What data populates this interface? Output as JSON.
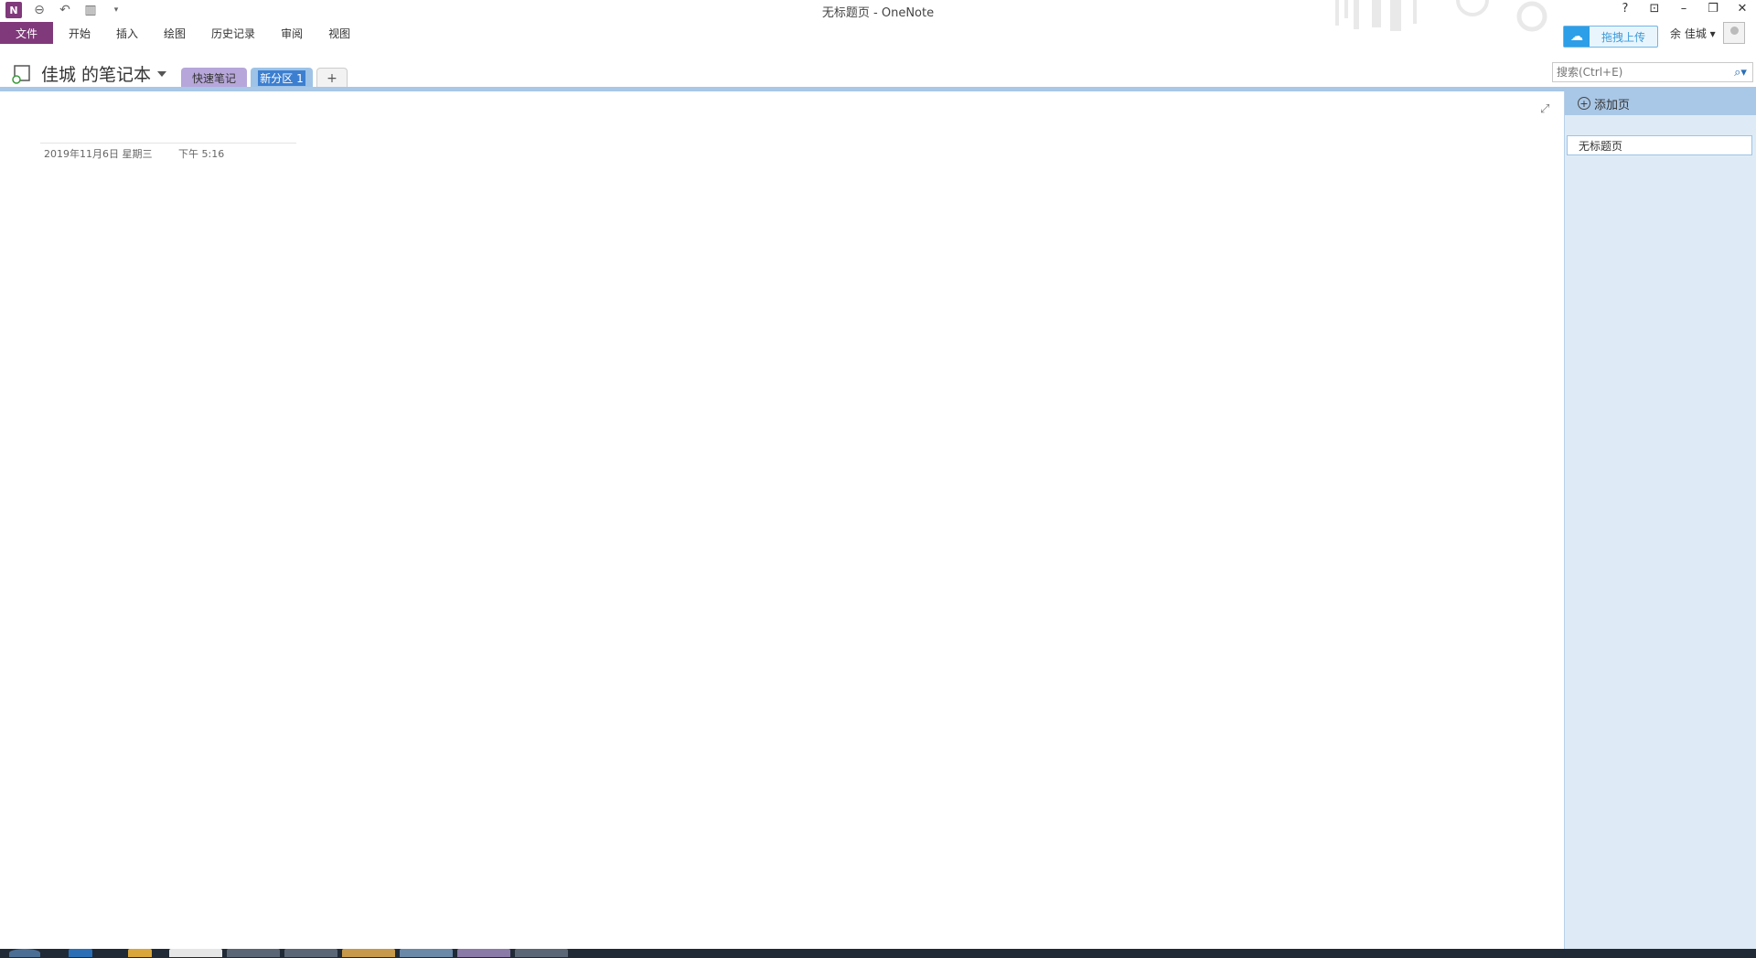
{
  "window": {
    "title": "无标题页 - OneNote",
    "controls": {
      "help": "?",
      "ribbon_display": "⊡",
      "minimize": "–",
      "restore": "❐",
      "close": "✕"
    }
  },
  "qat": {
    "logo": "N",
    "icons": [
      "back-icon",
      "undo-icon",
      "dock-icon",
      "customize-icon"
    ]
  },
  "ribbon": {
    "file": "文件",
    "tabs": [
      "开始",
      "插入",
      "绘图",
      "历史记录",
      "审阅",
      "视图"
    ]
  },
  "account": {
    "upload_label": "拖拽上传",
    "user_name": "余 佳城 ▾"
  },
  "notebook": {
    "title": "佳城 的笔记本",
    "sections": {
      "quick": "快速笔记",
      "active": "新分区 1",
      "add": "+"
    }
  },
  "search": {
    "placeholder": "搜索(Ctrl+E)"
  },
  "page": {
    "date": "2019年11月6日 星期三",
    "time": "下午 5:16"
  },
  "pages_pane": {
    "add_page": "添加页",
    "items": [
      "无标题页"
    ]
  },
  "colors": {
    "onenote_purple": "#80397b",
    "pane_blue": "#deebf6",
    "accent_blue": "#a9c7e6"
  }
}
